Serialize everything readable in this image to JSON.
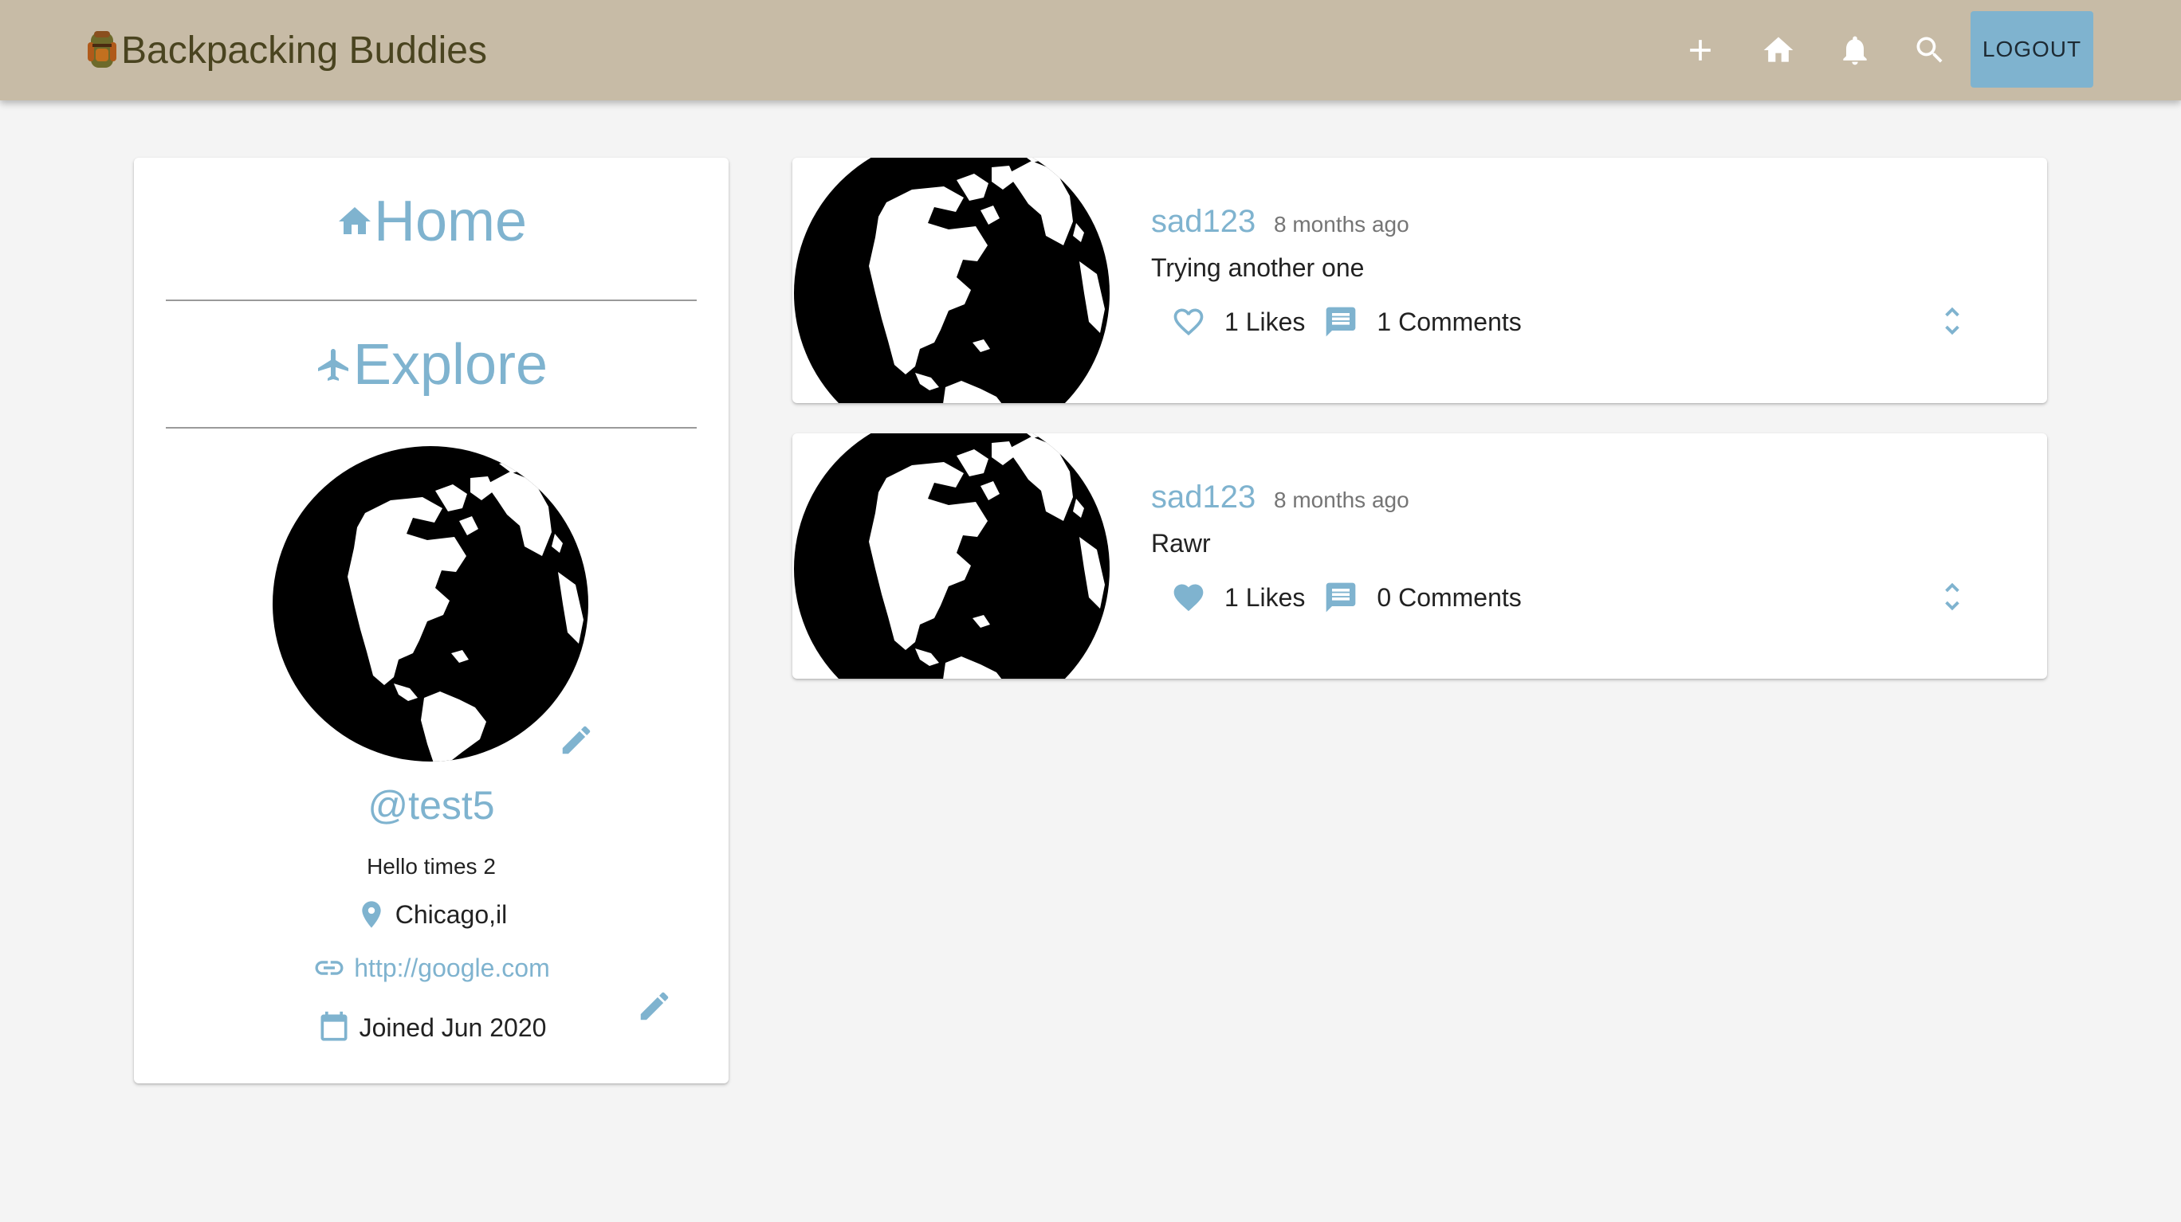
{
  "header": {
    "title": "Backpacking Buddies",
    "logout_label": "LOGOUT",
    "logo_icon": "backpack-icon",
    "nav_icons": [
      "add-icon",
      "home-icon",
      "bell-icon",
      "search-icon"
    ],
    "bar_color": "#c7bba6"
  },
  "sidebar": {
    "nav": [
      {
        "label": "Home",
        "icon": "home-icon"
      },
      {
        "label": "Explore",
        "icon": "airplane-icon"
      }
    ],
    "handle": "@test5",
    "bio": "Hello times 2",
    "location": "Chicago,il",
    "website": "http://google.com",
    "joined": "Joined Jun 2020"
  },
  "posts": [
    {
      "user": "sad123",
      "time": "8 months ago",
      "body": "Trying another one",
      "likes": "1 Likes",
      "comments": "1 Comments",
      "liked": false
    },
    {
      "user": "sad123",
      "time": "8 months ago",
      "body": "Rawr",
      "likes": "1 Likes",
      "comments": "0 Comments",
      "liked": true
    }
  ],
  "colors": {
    "accent": "#7fb3cf",
    "background": "#f4f4f4"
  }
}
